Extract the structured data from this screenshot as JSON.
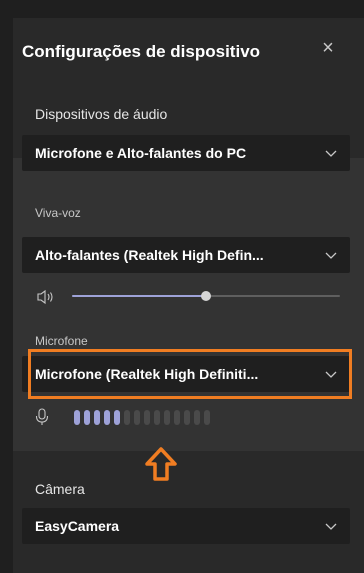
{
  "dialog": {
    "title": "Configurações de dispositivo",
    "close_glyph": "×"
  },
  "audio_devices": {
    "label": "Dispositivos de áudio",
    "selected": "Microfone e Alto-falantes do PC"
  },
  "speaker": {
    "label": "Viva-voz",
    "selected": "Alto-falantes (Realtek High Defin...",
    "volume_fraction": 0.5
  },
  "microphone": {
    "label": "Microfone",
    "selected": "Microfone (Realtek High Definiti...",
    "level_bars_total": 14,
    "level_bars_active": 5
  },
  "camera": {
    "label": "Câmera",
    "selected": "EasyCamera"
  },
  "colors": {
    "highlight": "#f07d22",
    "accent": "#9ea2d8",
    "meter_active": "#9ea2d8",
    "meter_inactive": "#4a4a4a"
  },
  "icons": {
    "close": "close-icon",
    "chevron": "chevron-down-icon",
    "speaker": "speaker-volume-icon",
    "mic": "microphone-icon",
    "arrow": "up-arrow-annotation-icon"
  }
}
